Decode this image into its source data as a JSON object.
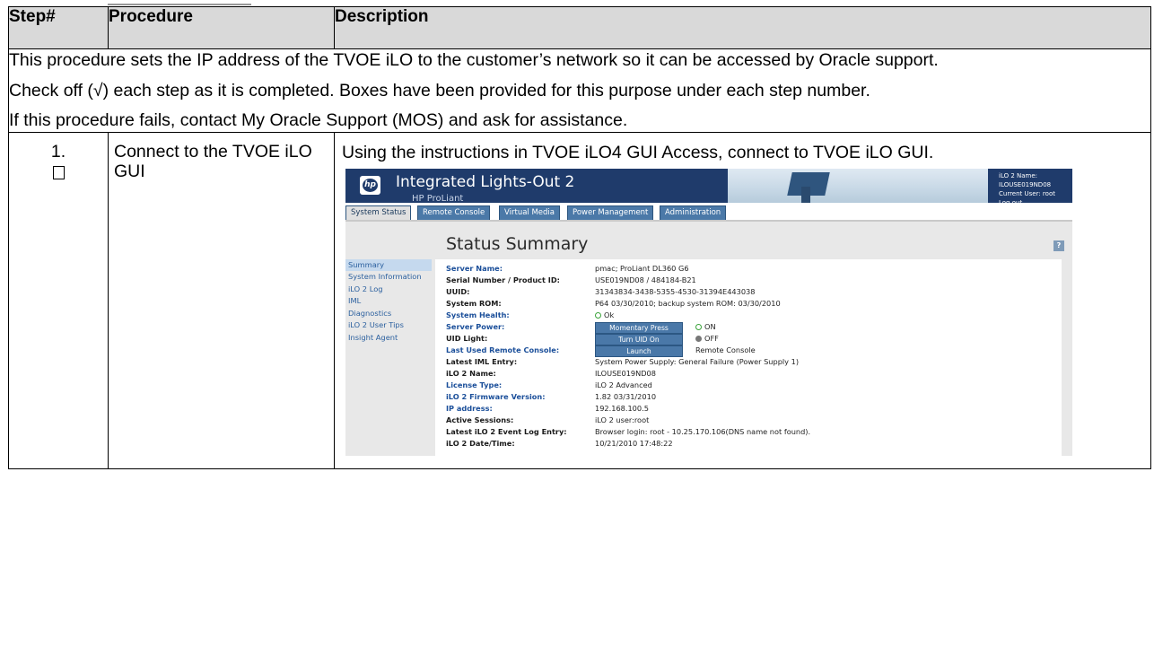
{
  "header": {
    "step": "Step#",
    "procedure": "Procedure",
    "description": "Description"
  },
  "intro": {
    "p1": "This procedure sets the IP address of the TVOE iLO to the customer’s network so it can be accessed by Oracle support.",
    "p2": "Check off (√) each step as it is completed.  Boxes have been provided for this purpose under each step number.",
    "p3": "If this procedure fails, contact My Oracle Support (MOS) and ask for assistance."
  },
  "step1": {
    "number": "1.",
    "procedure": "Connect to the TVOE iLO GUI",
    "description": "Using the instructions in TVOE iLO4 GUI Access, connect to TVOE iLO GUI."
  },
  "ilo": {
    "title": "Integrated Lights-Out 2",
    "subtitle": "HP ProLiant",
    "logo_text": "hp",
    "info_name": "iLO 2 Name: ILOUSE019ND08",
    "info_user": "Current User: root",
    "logout": "Log out",
    "tabs": [
      "System Status",
      "Remote Console",
      "Virtual Media",
      "Power Management",
      "Administration"
    ],
    "heading": "Status Summary",
    "help": "?",
    "nav": [
      "Summary",
      "System Information",
      "iLO 2 Log",
      "IML",
      "Diagnostics",
      "iLO 2 User Tips",
      "Insight Agent"
    ],
    "rows": [
      {
        "key": "Server Name:",
        "value": "pmac; ProLiant DL360 G6"
      },
      {
        "key": "Serial Number / Product ID:",
        "value": "USE019ND08 / 484184-B21"
      },
      {
        "key": "UUID:",
        "value": "31343834-3438-5355-4530-31394E443038"
      },
      {
        "key": "System ROM:",
        "value": "P64  03/30/2010; backup system ROM: 03/30/2010"
      },
      {
        "key": "System Health:",
        "value": "Ok"
      },
      {
        "key": "Server Power:",
        "button": "Momentary Press",
        "value": "ON"
      },
      {
        "key": "UID Light:",
        "button": "Turn UID On",
        "value": "OFF"
      },
      {
        "key": "Last Used Remote Console:",
        "button": "Launch",
        "value": "Remote Console"
      },
      {
        "key": "Latest IML Entry:",
        "value": "System Power Supply: General Failure (Power Supply 1)"
      },
      {
        "key": "iLO 2 Name:",
        "value": "ILOUSE019ND08"
      },
      {
        "key": "License Type:",
        "value": "iLO 2 Advanced"
      },
      {
        "key": "iLO 2 Firmware Version:",
        "value": "1.82  03/31/2010"
      },
      {
        "key": "IP address:",
        "value": "192.168.100.5"
      },
      {
        "key": "Active Sessions:",
        "value": "iLO 2 user:root"
      },
      {
        "key": "Latest iLO 2 Event Log Entry:",
        "value": "Browser login: root - 10.25.170.106(DNS name not found)."
      },
      {
        "key": "iLO 2 Date/Time:",
        "value": "10/21/2010 17:48:22"
      }
    ]
  }
}
